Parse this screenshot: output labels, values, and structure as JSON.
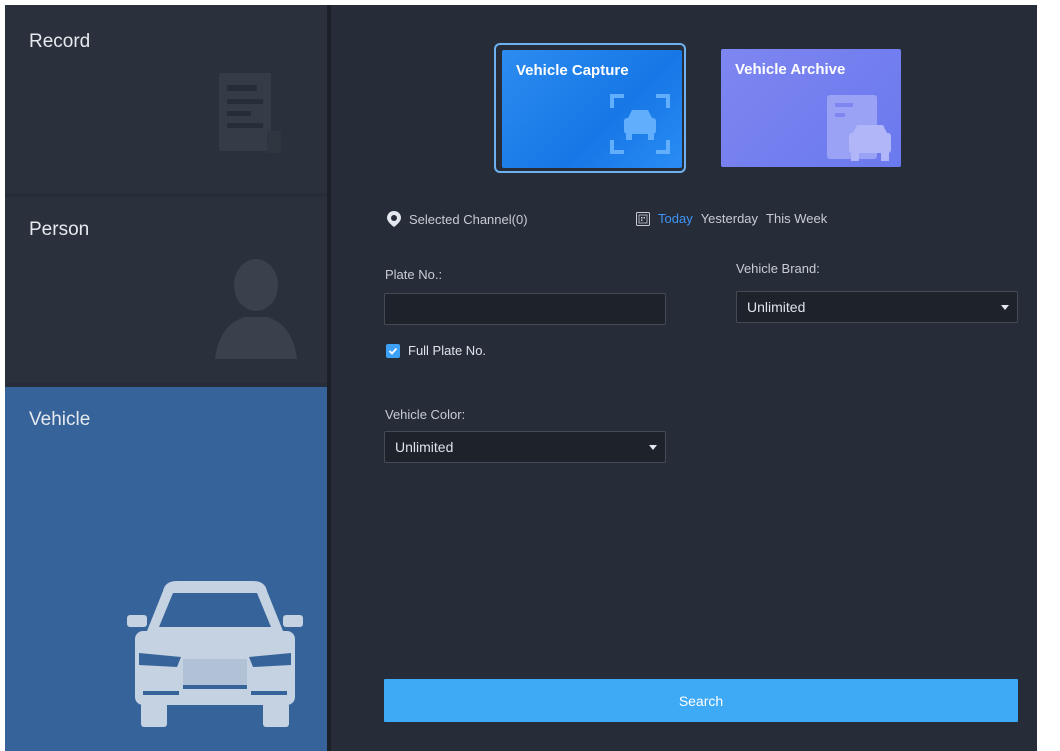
{
  "categories": {
    "record": "Record",
    "person": "Person",
    "vehicle": "Vehicle",
    "selected": "vehicle"
  },
  "modes": {
    "capture": "Vehicle Capture",
    "archive": "Vehicle Archive",
    "selected": "capture"
  },
  "channel": {
    "label": "Selected Channel(0)",
    "icon": "location-pin-icon"
  },
  "dates": {
    "icon": "calendar-icon",
    "today": "Today",
    "yesterday": "Yesterday",
    "this_week": "This Week",
    "selected": "today"
  },
  "form": {
    "plate_label": "Plate No.:",
    "plate_value": "",
    "full_plate_label": "Full Plate No.",
    "full_plate_checked": true,
    "brand_label": "Vehicle Brand:",
    "brand_value": "Unlimited",
    "color_label": "Vehicle Color:",
    "color_value": "Unlimited",
    "search_label": "Search"
  },
  "colors": {
    "accent": "#3ea9f5",
    "selected_category": "#36649a",
    "background": "#272d38"
  }
}
